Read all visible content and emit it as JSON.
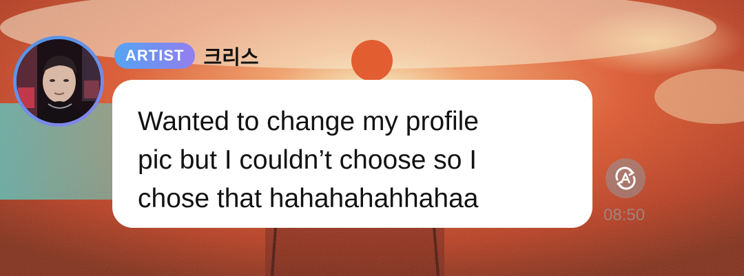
{
  "message": {
    "badge_label": "ARTIST",
    "sender_name": "크리스",
    "text": "Wanted to change my profile\npic but I couldn’t choose so I\nchose that hahahahahhahaa",
    "timestamp": "08:50"
  },
  "icons": {
    "avatar": "profile-photo",
    "translate": "translate-icon"
  },
  "colors": {
    "badge_gradient_start": "#55a4f4",
    "badge_gradient_end": "#937ff0",
    "avatar_ring": "#6d8ee8",
    "bubble": "#ffffff",
    "text": "#121212"
  }
}
